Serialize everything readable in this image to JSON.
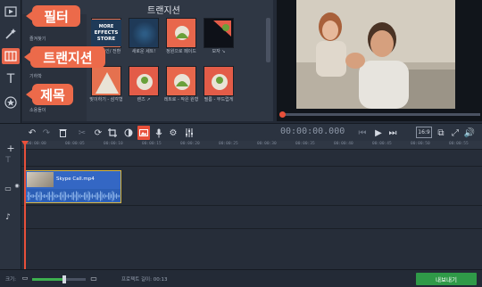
{
  "callouts": {
    "filters": "필터",
    "transitions": "트랜지션",
    "titles": "제목"
  },
  "panel": {
    "title": "트랜지션",
    "categories": [
      "즐겨찾기",
      "",
      "",
      "",
      "",
      "",
      "기하학",
      "",
      "",
      "소용돌이"
    ],
    "transitions": [
      {
        "label": "페이드 인/ 전환",
        "color": "#e5714f"
      },
      {
        "label": "새로운 세트!",
        "color": "#1f3a58"
      },
      {
        "label": "정원으로 페이드",
        "color": "#e8674c"
      },
      {
        "label": "모자 ↘",
        "color": "#0e1118"
      },
      {
        "label": "맞이하기 - 삼각형",
        "color": "#e5714f"
      },
      {
        "label": "렌즈 ↗",
        "color": "#e35c48"
      },
      {
        "label": "레트로 - 작은 원형",
        "color": "#e8674c"
      },
      {
        "label": "필름 - 부드럽게",
        "color": "#e35c48"
      }
    ],
    "promo_text": [
      "MORE",
      "EFFECTS",
      "STORE"
    ]
  },
  "toolbar": {
    "timecode": "00:00:00.000",
    "aspect": "16:9"
  },
  "timeline": {
    "ruler_ticks": [
      "00:00:00",
      "00:00:05",
      "00:00:10",
      "00:00:15",
      "00:00:20",
      "00:00:25",
      "00:00:30",
      "00:00:35",
      "00:00:40",
      "00:00:45",
      "00:00:50",
      "00:00:55"
    ],
    "clip_name": "Skype Call.mp4"
  },
  "status": {
    "scale_label": "크기:",
    "duration_label": "프로젝트 길이: 00:13",
    "zoom_level": 0.6,
    "export_label": "내보내기"
  },
  "colors": {
    "accent": "#ec6a4a",
    "playhead": "#e8503a",
    "export": "#2f9a48",
    "clip": "#3467c4"
  }
}
